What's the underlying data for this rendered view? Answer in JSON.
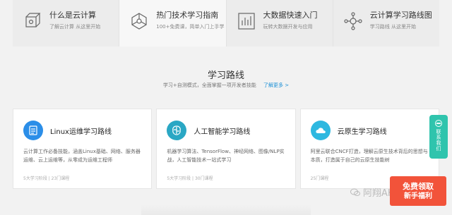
{
  "nav": {
    "tabs": [
      {
        "title": "什么是云计算",
        "sub": "了解云计算 从这里开始",
        "icon": "cube-icon"
      },
      {
        "title": "热门技术学习指南",
        "sub": "100+免费课，简单入门上手学",
        "icon": "network-icon"
      },
      {
        "title": "大数据快速入门",
        "sub": "玩转大数据开发与应用",
        "icon": "bar-chart-icon"
      },
      {
        "title": "云计算学习路线图",
        "sub": "学习路线 从这里开始",
        "icon": "route-icon"
      }
    ]
  },
  "section": {
    "title": "学习路线",
    "subtitle": "学习+自测模式，全面掌握一项开发者技能",
    "more": "了解更多 >"
  },
  "cards": [
    {
      "title": "Linux运维学习路线",
      "desc": "云计算工作必备技能，涵盖Linux基础、网络、服务器运维、云上运维等，从零成为运维工程师",
      "meta": "5大学习阶段 | 23门课程",
      "color": "#2b8ee8",
      "icon": "linux-file-icon"
    },
    {
      "title": "人工智能学习路线",
      "desc": "机器学习算法、TensorFlow、神经网络、图像/NLP实战，人工智能技术一站式学习",
      "meta": "5大学习阶段 | 30门课程",
      "color": "#2aa7c4",
      "icon": "brain-icon"
    },
    {
      "title": "云原生学习路线",
      "desc": "阿里云联合CNCF打造，理解云原生技术背后的思想与本质，打造属于自己的云原生技能树",
      "meta": "25门课程",
      "color": "#2eb8e0",
      "icon": "cloud-icon"
    }
  ],
  "contact": {
    "label": "联系我们"
  },
  "promo": {
    "line1": "免费领取",
    "line2": "新手福利"
  },
  "watermark": {
    "text": "阿翔AKHU"
  }
}
